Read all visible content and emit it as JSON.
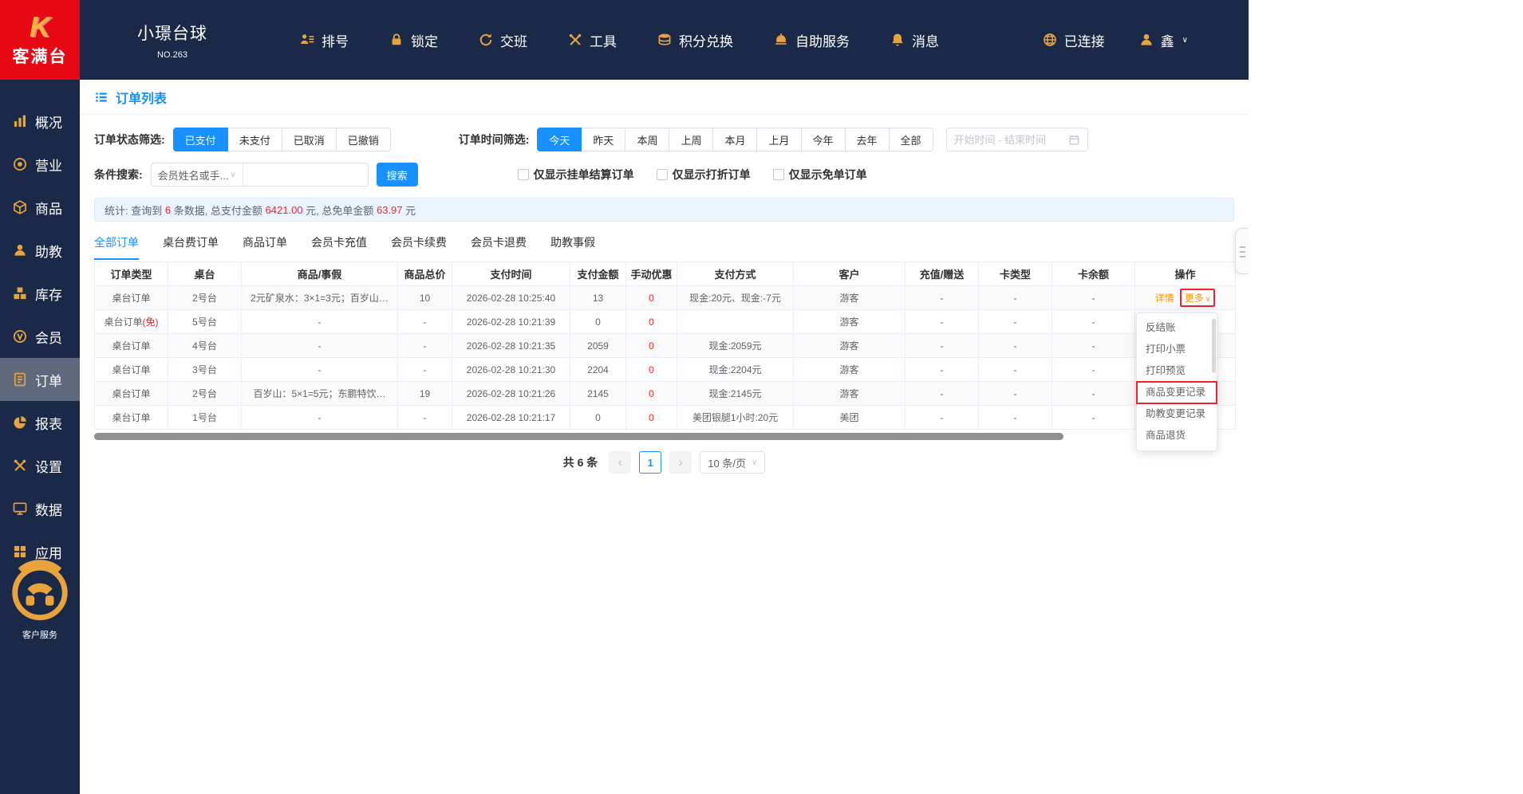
{
  "colors": {
    "navbar_bg": "#1a2947",
    "logo_bg": "#e60914",
    "icon_gold": "#e8a33d",
    "accent_blue": "#1890ff",
    "danger_red": "#f5222d",
    "link_orange": "#ff9700",
    "annotation_red": "#f5222d",
    "stats_bg": "#ecf5ff"
  },
  "icons": {
    "chevron_down": "∨",
    "prev_arrow": "‹",
    "next_arrow": "›"
  },
  "topbar": {
    "logo_k": "K",
    "logo_text": "客满台",
    "store_name": "小璟台球",
    "store_no": "NO.263",
    "nav": [
      {
        "label": "排号"
      },
      {
        "label": "锁定"
      },
      {
        "label": "交班"
      },
      {
        "label": "工具"
      },
      {
        "label": "积分兑换"
      },
      {
        "label": "自助服务"
      },
      {
        "label": "消息"
      },
      {
        "label": "已连接"
      },
      {
        "label": "鑫"
      }
    ]
  },
  "sidebar": {
    "items": [
      {
        "label": "概况"
      },
      {
        "label": "营业"
      },
      {
        "label": "商品"
      },
      {
        "label": "助教"
      },
      {
        "label": "库存"
      },
      {
        "label": "会员"
      },
      {
        "label": "订单",
        "cls": "active"
      },
      {
        "label": "报表"
      },
      {
        "label": "设置"
      },
      {
        "label": "数据"
      },
      {
        "label": "应用"
      }
    ],
    "service_label": "客户服务"
  },
  "page": {
    "title": "订单列表"
  },
  "filters": {
    "status_label": "订单状态筛选:",
    "status_options": [
      {
        "label": "已支付",
        "cls": "active"
      },
      {
        "label": "未支付"
      },
      {
        "label": "已取消"
      },
      {
        "label": "已撤销"
      }
    ],
    "time_label": "订单时间筛选:",
    "time_options": [
      {
        "label": "今天",
        "cls": "active"
      },
      {
        "label": "昨天"
      },
      {
        "label": "本周"
      },
      {
        "label": "上周"
      },
      {
        "label": "本月"
      },
      {
        "label": "上月"
      },
      {
        "label": "今年"
      },
      {
        "label": "去年"
      },
      {
        "label": "全部"
      }
    ],
    "date_placeholder": "开始时间 - 结束时间",
    "search_label": "条件搜索:",
    "search_select_value": "会员姓名或手...",
    "search_input_value": "",
    "search_button": "搜索",
    "checkboxes": [
      {
        "label": "仅显示挂单结算订单"
      },
      {
        "label": "仅显示打折订单"
      },
      {
        "label": "仅显示免单订单"
      }
    ]
  },
  "stats": {
    "prefix": "统计: 查询到 ",
    "count": "6",
    "mid1": " 条数据, 总支付金额 ",
    "total_amount": "6421.00",
    "mid2": " 元, 总免单金额 ",
    "free_amount": "63.97",
    "suffix": " 元"
  },
  "tabs": [
    {
      "label": "全部订单",
      "cls": "active"
    },
    {
      "label": "桌台费订单"
    },
    {
      "label": "商品订单"
    },
    {
      "label": "会员卡充值"
    },
    {
      "label": "会员卡续费"
    },
    {
      "label": "会员卡退费"
    },
    {
      "label": "助教事假"
    }
  ],
  "table": {
    "columns": [
      "订单类型",
      "桌台",
      "商品/事假",
      "商品总价",
      "支付时间",
      "支付金额",
      "手动优惠",
      "支付方式",
      "客户",
      "充值/赠送",
      "卡类型",
      "卡余额",
      "操作"
    ],
    "actions": {
      "detail": "详情",
      "more": "更多",
      "more_chevron": "∨"
    },
    "rows": [
      {
        "type": "桌台订单",
        "type_flag": "",
        "table": "2号台",
        "goods": "2元矿泉水：3×1=3元；百岁山…",
        "total": "10",
        "time": "2026-02-28 10:25:40",
        "amount": "13",
        "discount": "0",
        "method": "现金:20元、现金:-7元",
        "customer": "游客",
        "recharge": "-",
        "card_type": "-",
        "balance": "-",
        "more_cls": "annotated"
      },
      {
        "type": "桌台订单",
        "type_flag": "(免)",
        "table": "5号台",
        "goods": "-",
        "total": "-",
        "time": "2026-02-28 10:21:39",
        "amount": "0",
        "discount": "0",
        "method": "",
        "customer": "游客",
        "recharge": "-",
        "card_type": "-",
        "balance": "-"
      },
      {
        "type": "桌台订单",
        "type_flag": "",
        "table": "4号台",
        "goods": "-",
        "total": "-",
        "time": "2026-02-28 10:21:35",
        "amount": "2059",
        "discount": "0",
        "method": "现金:2059元",
        "customer": "游客",
        "recharge": "-",
        "card_type": "-",
        "balance": "-"
      },
      {
        "type": "桌台订单",
        "type_flag": "",
        "table": "3号台",
        "goods": "-",
        "total": "-",
        "time": "2026-02-28 10:21:30",
        "amount": "2204",
        "discount": "0",
        "method": "现金:2204元",
        "customer": "游客",
        "recharge": "-",
        "card_type": "-",
        "balance": "-"
      },
      {
        "type": "桌台订单",
        "type_flag": "",
        "table": "2号台",
        "goods": "百岁山：5×1=5元；东鹏特饮…",
        "total": "19",
        "time": "2026-02-28 10:21:26",
        "amount": "2145",
        "discount": "0",
        "method": "现金:2145元",
        "customer": "游客",
        "recharge": "-",
        "card_type": "-",
        "balance": "-"
      },
      {
        "type": "桌台订单",
        "type_flag": "",
        "table": "1号台",
        "goods": "-",
        "total": "-",
        "time": "2026-02-28 10:21:17",
        "amount": "0",
        "discount": "0",
        "method": "美团银腿1小时:20元",
        "customer": "美团",
        "recharge": "-",
        "card_type": "-",
        "balance": "-"
      }
    ]
  },
  "dropdown": {
    "items": [
      {
        "label": "反结账"
      },
      {
        "label": "打印小票"
      },
      {
        "label": "打印预览"
      },
      {
        "label": "商品变更记录",
        "cls": "annotated"
      },
      {
        "label": "助教变更记录"
      },
      {
        "label": "商品退货"
      }
    ]
  },
  "pagination": {
    "total": "共 6 条",
    "page": "1",
    "page_size": "10 条/页"
  }
}
